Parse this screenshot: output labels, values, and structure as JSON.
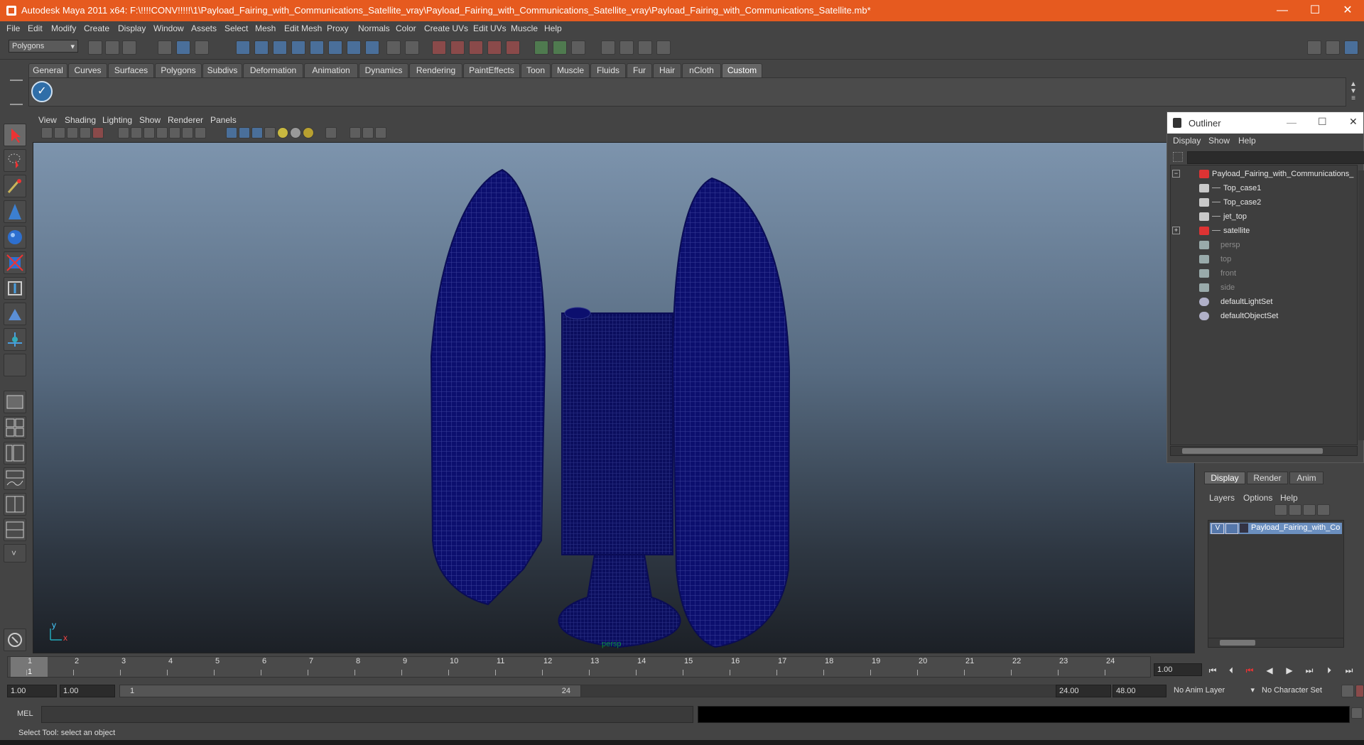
{
  "window": {
    "title": "Autodesk Maya 2011 x64: F:\\!!!!CONV!!!!!\\1\\Payload_Fairing_with_Communications_Satellite_vray\\Payload_Fairing_with_Communications_Satellite_vray\\Payload_Fairing_with_Communications_Satellite.mb*",
    "minimize": "—",
    "maximize": "☐",
    "close": "✕"
  },
  "menubar": [
    "File",
    "Edit",
    "Modify",
    "Create",
    "Display",
    "Window",
    "Assets",
    "Select",
    "Mesh",
    "Edit Mesh",
    "Proxy",
    "Normals",
    "Color",
    "Create UVs",
    "Edit UVs",
    "Muscle",
    "Help"
  ],
  "statusline": {
    "mode": "Polygons"
  },
  "shelf_tabs": [
    "General",
    "Curves",
    "Surfaces",
    "Polygons",
    "Subdivs",
    "Deformation",
    "Animation",
    "Dynamics",
    "Rendering",
    "PaintEffects",
    "Toon",
    "Muscle",
    "Fluids",
    "Fur",
    "Hair",
    "nCloth",
    "Custom"
  ],
  "shelf_active": "Custom",
  "viewport": {
    "menu": [
      "View",
      "Shading",
      "Lighting",
      "Show",
      "Renderer",
      "Panels"
    ],
    "camera": "persp",
    "axis_y": "y",
    "axis_x": "x"
  },
  "outliner": {
    "title": "Outliner",
    "menu": [
      "Display",
      "Show",
      "Help"
    ],
    "items": [
      {
        "label": "Payload_Fairing_with_Communications_",
        "dim": false
      },
      {
        "label": "Top_case1",
        "dim": false
      },
      {
        "label": "Top_case2",
        "dim": false
      },
      {
        "label": "jet_top",
        "dim": false
      },
      {
        "label": "satellite",
        "dim": false
      },
      {
        "label": "persp",
        "dim": true
      },
      {
        "label": "top",
        "dim": true
      },
      {
        "label": "front",
        "dim": true
      },
      {
        "label": "side",
        "dim": true
      },
      {
        "label": "defaultLightSet",
        "dim": false
      },
      {
        "label": "defaultObjectSet",
        "dim": false
      }
    ]
  },
  "layer_editor": {
    "tabs": [
      "Display",
      "Render",
      "Anim"
    ],
    "menu": [
      "Layers",
      "Options",
      "Help"
    ],
    "layer": {
      "visible": "V",
      "name": "Payload_Fairing_with_Co"
    }
  },
  "timeline": {
    "ticks": [
      "1",
      "2",
      "3",
      "4",
      "5",
      "6",
      "7",
      "8",
      "9",
      "10",
      "11",
      "12",
      "13",
      "14",
      "15",
      "16",
      "17",
      "18",
      "19",
      "20",
      "21",
      "22",
      "23",
      "24"
    ],
    "current_frame": "1",
    "current_time": "1.00"
  },
  "range": {
    "start": "1.00",
    "playback_start": "1.00",
    "slider_start": "1",
    "slider_end": "24",
    "playback_end": "24.00",
    "end": "48.00",
    "anim_layer": "No Anim Layer",
    "character_set": "No Character Set"
  },
  "command_line": {
    "label": "MEL"
  },
  "help_line": "Select Tool: select an object"
}
